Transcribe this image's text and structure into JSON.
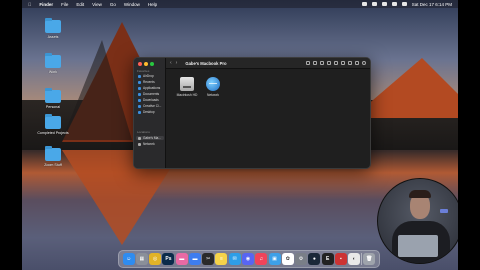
{
  "menubar": {
    "apple": "",
    "items": [
      "Finder",
      "File",
      "Edit",
      "View",
      "Go",
      "Window",
      "Help"
    ],
    "clock": "Sat Dec 17  6:14 PM"
  },
  "desktop": {
    "icons": [
      {
        "label": "Assets",
        "icon": "folder-icon"
      },
      {
        "label": "Work",
        "icon": "folder-icon"
      },
      {
        "label": "Personal",
        "icon": "folder-icon"
      },
      {
        "label": "Completed Projects",
        "icon": "folder-icon"
      },
      {
        "label": "Zoom Stuff",
        "icon": "folder-icon"
      }
    ]
  },
  "finder": {
    "title": "Gabe's Macbook Pro",
    "sidebar": {
      "favorites_label": "Favorites",
      "favorites": [
        "AirDrop",
        "Recents",
        "Applications",
        "Documents",
        "Downloads",
        "Creative Cl...",
        "Desktop"
      ],
      "locations_label": "Locations",
      "locations": [
        "Gabe's Ma...",
        "Network"
      ]
    },
    "items": [
      {
        "label": "Macintosh HD",
        "icon": "hard-drive-icon"
      },
      {
        "label": "Network",
        "icon": "network-globe-icon"
      }
    ]
  },
  "dock": {
    "apps": [
      {
        "name": "finder-icon",
        "glyph": "☺",
        "color": "#2e8cf0"
      },
      {
        "name": "launchpad-icon",
        "glyph": "▦",
        "color": "#8a8f99"
      },
      {
        "name": "chrome-icon",
        "glyph": "◎",
        "color": "#e2b328"
      },
      {
        "name": "photoshop-icon",
        "glyph": "Ps",
        "color": "#0a2a4a"
      },
      {
        "name": "folder-icon",
        "glyph": "▬",
        "color": "#e96aa4"
      },
      {
        "name": "folder-2-icon",
        "glyph": "▬",
        "color": "#3d7df0"
      },
      {
        "name": "final-cut-icon",
        "glyph": "✂",
        "color": "#2a2a2a"
      },
      {
        "name": "notes-icon",
        "glyph": "≡",
        "color": "#f5d34a"
      },
      {
        "name": "messages-icon",
        "glyph": "✉",
        "color": "#2e9ee8"
      },
      {
        "name": "discord-icon",
        "glyph": "◉",
        "color": "#5865f2"
      },
      {
        "name": "music-icon",
        "glyph": "♫",
        "color": "#f0445a"
      },
      {
        "name": "preview-icon",
        "glyph": "▣",
        "color": "#3da0e8"
      },
      {
        "name": "photos-icon",
        "glyph": "✿",
        "color": "#ffffff"
      },
      {
        "name": "settings-icon",
        "glyph": "⚙",
        "color": "#7a7f88"
      },
      {
        "name": "steam-icon",
        "glyph": "●",
        "color": "#1b2838"
      },
      {
        "name": "epic-games-icon",
        "glyph": "E",
        "color": "#222222"
      },
      {
        "name": "system-icon",
        "glyph": "▪",
        "color": "#cc3333"
      },
      {
        "name": "github-icon",
        "glyph": "◐",
        "color": "#e8e8e8"
      },
      {
        "name": "trash-icon",
        "glyph": "🗑",
        "color": "#9ea3ab"
      }
    ]
  },
  "colors": {
    "close": "#ff5f57",
    "minimize": "#febc2e",
    "zoom": "#28c840"
  }
}
